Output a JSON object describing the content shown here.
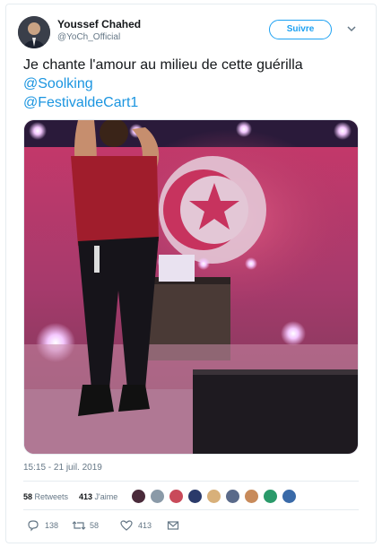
{
  "author": {
    "name": "Youssef Chahed",
    "handle": "@YoCh_Official",
    "follow_label": "Suivre"
  },
  "tweet": {
    "text": "Je chante l'amour au milieu de cette guérilla",
    "mentions": [
      "@Soolking",
      "@FestivaldeCart1"
    ],
    "timestamp": "15:15 - 21 juil. 2019"
  },
  "stats": {
    "retweets_count": "58",
    "retweets_label": "Retweets",
    "likes_count": "413",
    "likes_label": "J'aime"
  },
  "actions": {
    "reply_count": "138",
    "retweet_count": "58",
    "like_count": "413"
  },
  "icons": {
    "caret": "chevron-down-icon",
    "reply": "reply-icon",
    "retweet": "retweet-icon",
    "like": "heart-icon",
    "dm": "mail-icon"
  },
  "colors": {
    "link": "#1b95e0",
    "follow": "#1da1f2",
    "muted": "#657786"
  }
}
